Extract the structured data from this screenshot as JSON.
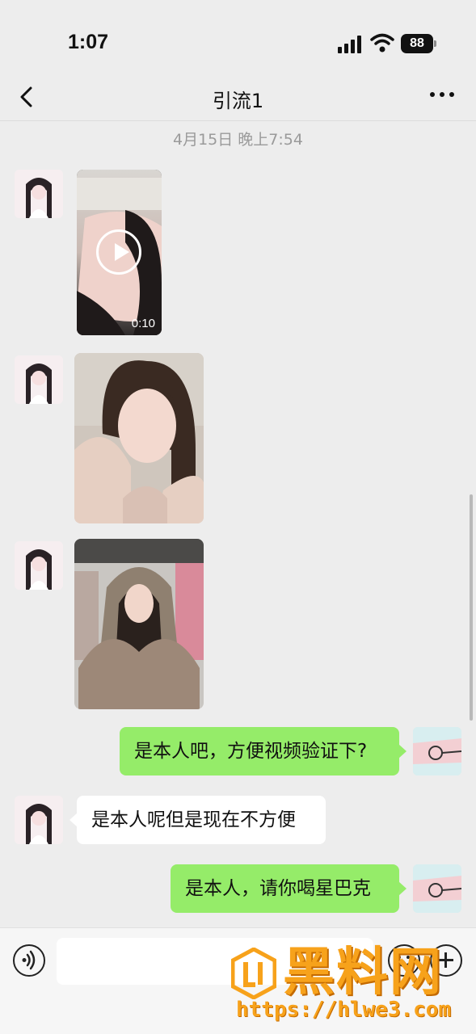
{
  "status_bar": {
    "time": "1:07",
    "battery": "88",
    "icons": [
      "signal-icon",
      "wifi-icon",
      "battery-icon"
    ]
  },
  "nav": {
    "title": "引流1",
    "back_icon": "chevron-left-icon",
    "more_icon": "more-dots-icon"
  },
  "chat": {
    "timestamp": "4月15日 晚上7:54",
    "video": {
      "duration": "0:10"
    },
    "messages": {
      "out_1": "是本人吧，方便视频验证下?",
      "in_1": "是本人呢但是现在不方便",
      "out_2": "是本人，请你喝星巴克"
    }
  },
  "input_bar": {
    "placeholder": "",
    "icons": [
      "voice-icon",
      "emoji-icon",
      "plus-icon"
    ]
  },
  "watermark": {
    "brand": "黑料网",
    "url": "https://hlwe3.com"
  },
  "colors": {
    "background": "#ededed",
    "outgoing_bubble": "#95ec69",
    "incoming_bubble": "#ffffff",
    "watermark": "#f7a21b"
  }
}
